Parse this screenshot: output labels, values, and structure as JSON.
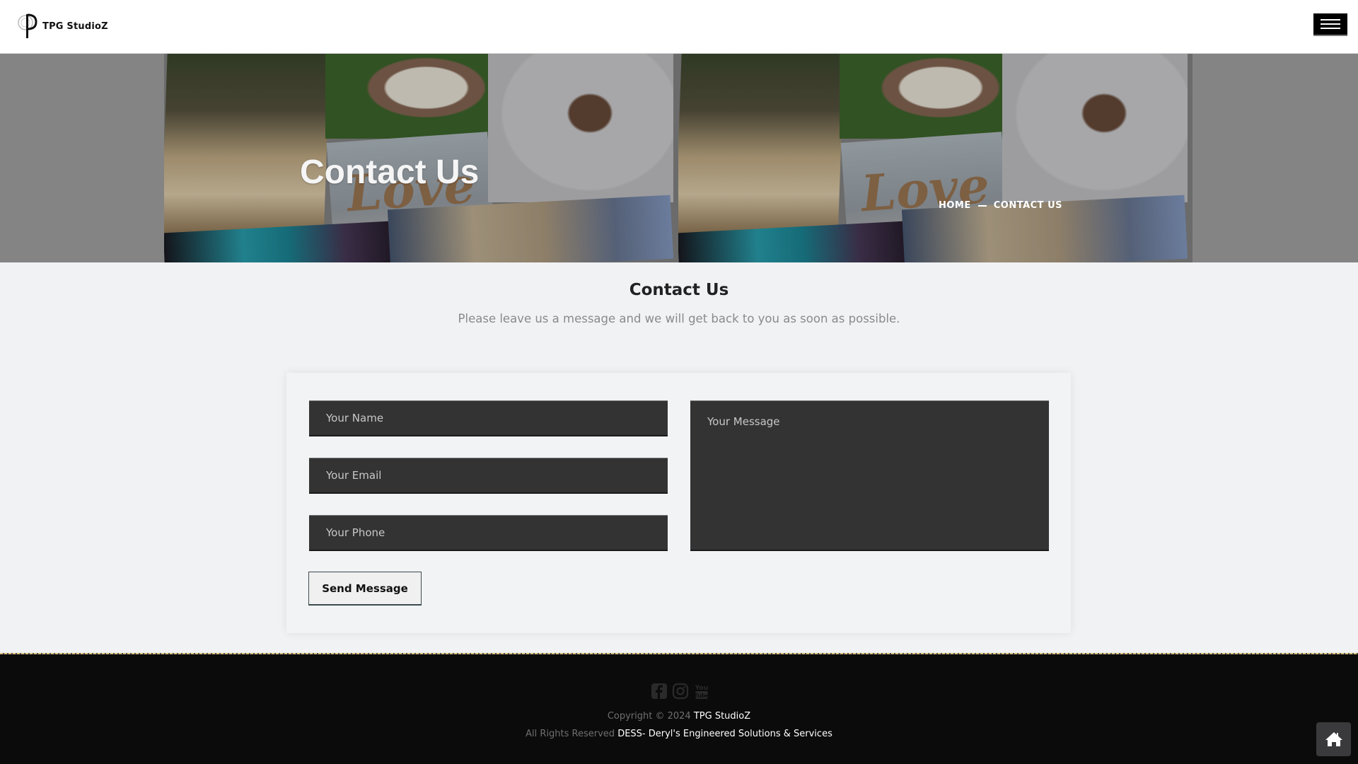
{
  "header": {
    "brand_name": "TPG StudioZ",
    "menu_icon": "hamburger-menu-icon"
  },
  "hero": {
    "title": "Contact Us",
    "breadcrumb": {
      "home": "HOME",
      "current": "CONTACT US"
    }
  },
  "section": {
    "title": "Contact Us",
    "subtitle": "Please leave us a message and we will get back to you as soon as possible."
  },
  "form": {
    "name_placeholder": "Your Name",
    "email_placeholder": "Your Email",
    "phone_placeholder": "Your Phone",
    "message_placeholder": "Your Message",
    "submit_label": "Send Message"
  },
  "footer": {
    "social": [
      "facebook-icon",
      "instagram-icon",
      "youtube-icon"
    ],
    "copyright_prefix": "Copyright © 2024",
    "copyright_link": "TPG StudioZ",
    "rights_prefix": "All Rights Reserved",
    "rights_link": "DESS- Deryl's Engineered Solutions & Services"
  },
  "back_to_home_icon": "home-icon",
  "colors": {
    "input_bg": "#333333",
    "footer_bg": "#0b0b0b",
    "page_bg": "#f1f2f4"
  }
}
